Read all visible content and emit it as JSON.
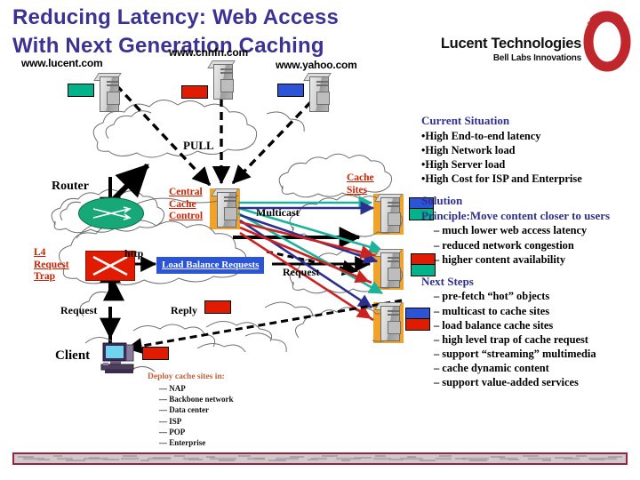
{
  "title": {
    "line1": "Reducing Latency: Web Access",
    "line2": "With Next Generation Caching",
    "color": "#3b3296"
  },
  "logo": {
    "company": "Lucent Technologies",
    "tagline": "Bell Labs Innovations",
    "mark_color": "#c0272d",
    "mark_name": "lucent-red-ring"
  },
  "origin_servers": [
    {
      "url": "www.lucent.com",
      "content_color": "#00b38a"
    },
    {
      "url": "www.cnnfn.com",
      "content_color": "#e01b00"
    },
    {
      "url": "www.yahoo.com",
      "content_color": "#2b55d6"
    }
  ],
  "diagram": {
    "pull_label": "PULL",
    "router_label": "Router",
    "central_cache_control": "Central\nCache\nControl",
    "central_cache_control_lines": [
      "Central",
      "Cache",
      "Control"
    ],
    "cache_sites_label_lines": [
      "Cache",
      "Sites"
    ],
    "multicast_label": "Multicast",
    "l4_trap_lines": [
      "L4",
      "Request",
      "Trap"
    ],
    "http_label": "http",
    "load_balance_label": "Load Balance Requests",
    "request_label_right": "Request",
    "request_label_left": "Request",
    "reply_label": "Reply",
    "client_label": "Client",
    "router_fill": "#17a878",
    "l4_fill": "#e01b00",
    "load_balance_fill": "#2b55d6",
    "cache_pad_fill": "#f0a32a",
    "label_red": "#cc2200",
    "multicast_line_colors": [
      "#1bb39a",
      "#2b2f8f",
      "#cc2222"
    ],
    "cache_site_contents": [
      [
        "#2b55d6",
        "#00b38a"
      ],
      [
        "#e01b00",
        "#00b38a"
      ],
      [
        "#2b55d6",
        "#e01b00"
      ]
    ]
  },
  "deploy": {
    "heading": "Deploy cache sites in:",
    "items": [
      "— NAP",
      "— Backbone network",
      "— Data center",
      "— ISP",
      "— POP",
      "— Enterprise"
    ],
    "heading_color": "#c4603a"
  },
  "right_column": {
    "sections": [
      {
        "heading": "Current Situation",
        "items": [
          "•High End-to-end latency",
          "•High Network load",
          "•High Server load",
          "•High Cost for ISP and Enterprise"
        ],
        "style": "bullet"
      },
      {
        "heading": "Solution",
        "subheading": "Principle:Move content closer to users",
        "items": [
          "– much lower web access latency",
          "– reduced network congestion",
          "– higher content availability"
        ],
        "style": "dash"
      },
      {
        "heading": "Next Steps",
        "items": [
          "– pre-fetch “hot” objects",
          "– multicast to cache sites",
          "– load balance cache sites",
          "– high level trap of cache request",
          "– support “streaming” multimedia",
          " – cache dynamic content",
          " – support value-added services"
        ],
        "style": "dash"
      }
    ],
    "heading_color": "#2f2f8f"
  },
  "footer": {
    "border_color": "#9b2242",
    "fill_color": "#cfc9cc"
  }
}
